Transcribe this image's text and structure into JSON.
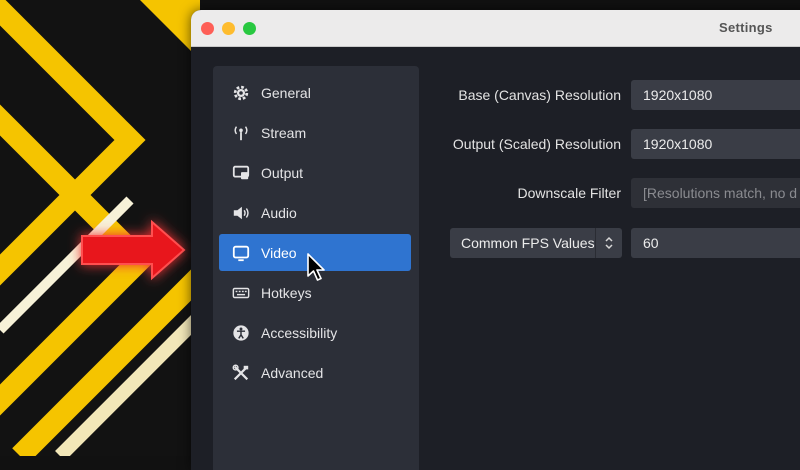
{
  "window": {
    "title": "Settings"
  },
  "sidebar": {
    "items": [
      {
        "label": "General",
        "icon": "gear-icon"
      },
      {
        "label": "Stream",
        "icon": "antenna-icon"
      },
      {
        "label": "Output",
        "icon": "output-icon"
      },
      {
        "label": "Audio",
        "icon": "speaker-icon"
      },
      {
        "label": "Video",
        "icon": "monitor-icon",
        "active": true
      },
      {
        "label": "Hotkeys",
        "icon": "keyboard-icon"
      },
      {
        "label": "Accessibility",
        "icon": "accessibility-icon"
      },
      {
        "label": "Advanced",
        "icon": "tools-icon"
      }
    ]
  },
  "video": {
    "base_label": "Base (Canvas) Resolution",
    "base_value": "1920x1080",
    "output_label": "Output (Scaled) Resolution",
    "output_value": "1920x1080",
    "downscale_label": "Downscale Filter",
    "downscale_value": "[Resolutions match, no d",
    "fps_type": "Common FPS Values",
    "fps_value": "60"
  },
  "colors": {
    "active_item": "#2f74d0",
    "accent_yellow": "#f5c400",
    "arrow_red": "#e8141b"
  }
}
